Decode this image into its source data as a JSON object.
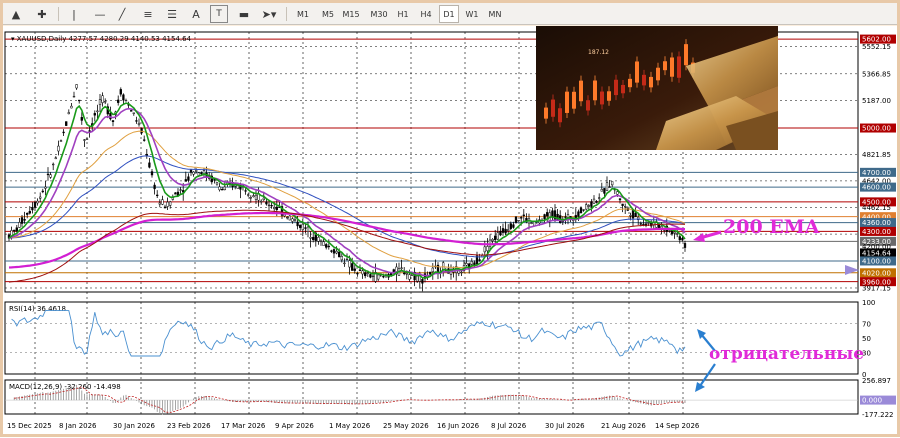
{
  "toolbar": {
    "timeframes": [
      {
        "label": "M1",
        "active": false
      },
      {
        "label": "M5",
        "active": false
      },
      {
        "label": "M15",
        "active": false
      },
      {
        "label": "M30",
        "active": false
      },
      {
        "label": "H1",
        "active": false
      },
      {
        "label": "H4",
        "active": false
      },
      {
        "label": "D1",
        "active": true
      },
      {
        "label": "W1",
        "active": false
      },
      {
        "label": "MN",
        "active": false
      }
    ]
  },
  "chart": {
    "symbol_line": "XAUUSD,Daily  4277.57 4280.29 4140.53 4154.64",
    "rsi_label": "RSI(14) 36.4618",
    "macd_label": "MACD(12,26,9) -32.260 -14.498",
    "photo_price_text": "187.12",
    "annotation_ema": "200 EMA",
    "annotation_negative": "отрицательные"
  },
  "price_axis": {
    "labels": [
      "5602.00",
      "5552.15",
      "5366.85",
      "5187.00",
      "5000.00",
      "4821.85",
      "4700.00",
      "4642.00",
      "4600.00",
      "4500.00",
      "4462.15",
      "4400.00",
      "4360.00",
      "4300.00",
      "4233.00",
      "4200.00",
      "4154.64",
      "4100.00",
      "4020.00",
      "3960.00",
      "3917.15"
    ],
    "level_colors": {
      "red": "#b00000",
      "teal": "#3f6a8a",
      "gray": "#6a6a6a",
      "orange": "#c07000"
    }
  },
  "rsi_axis": {
    "labels": [
      "100",
      "70",
      "50",
      "30",
      "0"
    ]
  },
  "macd_axis": {
    "labels": [
      "256.897",
      "0.000",
      "-177.222"
    ]
  },
  "date_axis": {
    "labels": [
      "15 Dec 2025",
      "8 Jan 2026",
      "30 Jan 2026",
      "23 Feb 2026",
      "17 Mar 2026",
      "9 Apr 2026",
      "1 May 2026",
      "25 May 2026",
      "16 Jun 2026",
      "8 Jul 2026",
      "30 Jul 2026",
      "21 Aug 2026",
      "14 Sep 2026"
    ]
  },
  "colors": {
    "ema_200": "#d21fd2",
    "ema_fast": "#1a9a1a",
    "ema_mid": "#a040c0",
    "ema_slow": "#e0a040",
    "ema_long": "#3050c0",
    "annotation": "#e02ad8",
    "arrow_blue": "#2a7fd0"
  }
}
